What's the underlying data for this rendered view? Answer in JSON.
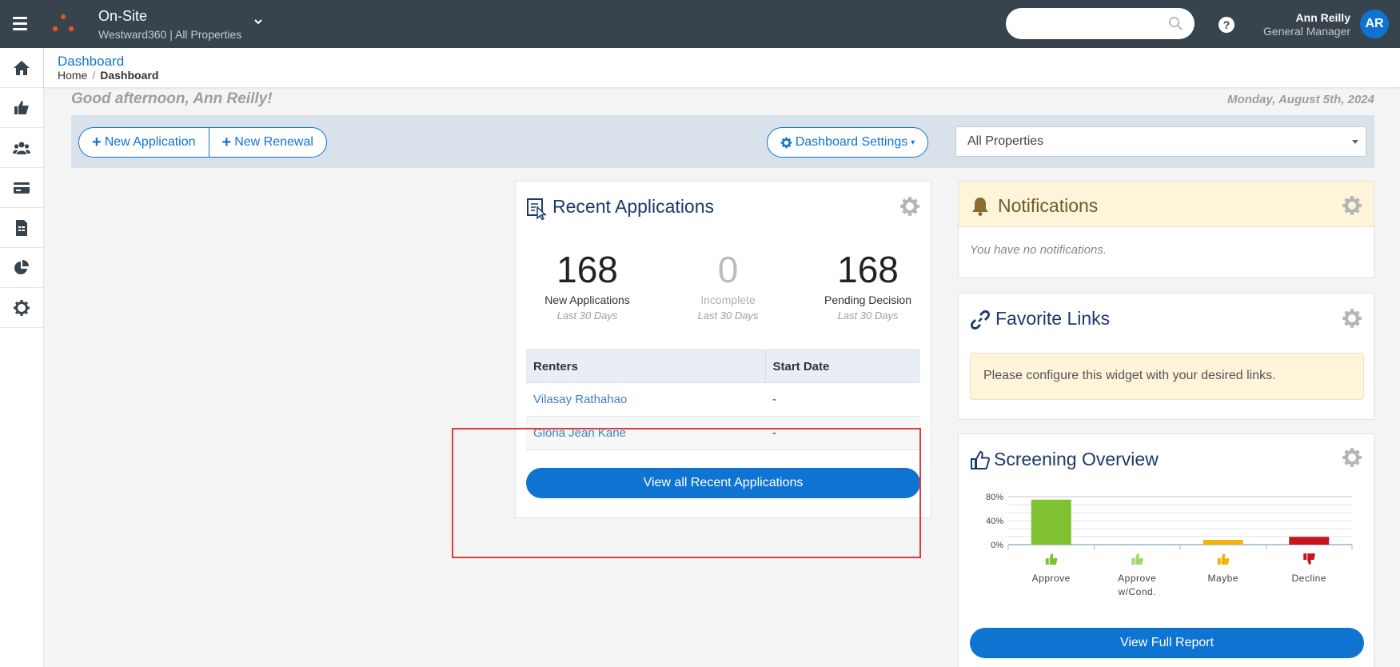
{
  "header": {
    "app_name": "On-Site",
    "app_sub": "Westward360 | All Properties",
    "search": {
      "placeholder": "",
      "value": ""
    },
    "user": {
      "name": "Ann Reilly",
      "role": "General Manager",
      "initials": "AR"
    },
    "colors": {
      "bar": "#37434d",
      "accent": "#0f74d1",
      "logo": "#e8501e"
    }
  },
  "sidebar": {
    "items": [
      {
        "icon": "home-icon"
      },
      {
        "icon": "thumbs-up-icon"
      },
      {
        "icon": "users-icon"
      },
      {
        "icon": "card-icon"
      },
      {
        "icon": "report-icon"
      },
      {
        "icon": "pie-chart-icon"
      },
      {
        "icon": "settings-icon"
      }
    ]
  },
  "breadcrumb": {
    "title": "Dashboard",
    "home": "Home",
    "separator": "/",
    "current": "Dashboard"
  },
  "greeting": "Good afternoon, Ann Reilly!",
  "date": "Monday, August 5th, 2024",
  "actions": {
    "new_application": "New Application",
    "new_renewal": "New Renewal",
    "dashboard_settings": "Dashboard Settings",
    "property_select": "All Properties"
  },
  "recent": {
    "title": "Recent Applications",
    "stats": [
      {
        "value": "168",
        "label": "New Applications",
        "sub": "Last 30 Days"
      },
      {
        "value": "0",
        "label": "Incomplete",
        "sub": "Last 30 Days"
      },
      {
        "value": "168",
        "label": "Pending Decision",
        "sub": "Last 30 Days"
      }
    ],
    "columns": [
      "Renters",
      "Start Date"
    ],
    "rows": [
      {
        "renter": "Vilasay Rathahao",
        "start": "-"
      },
      {
        "renter": "Gloria Jean Kane",
        "start": "-"
      }
    ],
    "view_all": "View all Recent Applications"
  },
  "notifications": {
    "title": "Notifications",
    "message": "You have no notifications."
  },
  "favorites": {
    "title": "Favorite Links",
    "note": "Please configure this widget with your desired links."
  },
  "screening": {
    "title": "Screening Overview",
    "view_full": "View Full Report"
  },
  "chart_data": {
    "type": "bar",
    "title": "",
    "categories": [
      "Approve",
      "Approve w/Cond.",
      "Maybe",
      "Decline"
    ],
    "category_lines": [
      [
        "Approve"
      ],
      [
        "Approve",
        "w/Cond."
      ],
      [
        "Maybe"
      ],
      [
        "Decline"
      ]
    ],
    "values": [
      75,
      0,
      8,
      13
    ],
    "colors": [
      "#7fc132",
      "#a5d66b",
      "#f2b40c",
      "#c8141e"
    ],
    "yticks": [
      "80%",
      "40%",
      "0%"
    ],
    "ylim": [
      0,
      80
    ],
    "xlabel": "",
    "ylabel": "",
    "grid": true
  }
}
